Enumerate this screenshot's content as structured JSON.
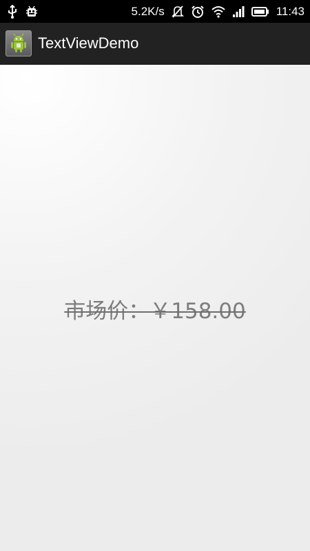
{
  "status_bar": {
    "net_speed": "5.2K/s",
    "time": "11:43",
    "icons": [
      "usb-icon",
      "debug-icon",
      "mute-icon",
      "alarm-icon",
      "wifi-icon",
      "signal-icon",
      "battery-icon"
    ]
  },
  "action_bar": {
    "title": "TextViewDemo",
    "icon": "android-app-icon"
  },
  "content": {
    "price_text": "市场价：￥158.00"
  },
  "colors": {
    "status_bar_bg": "#000000",
    "action_bar_bg": "#222222",
    "content_bg": "#ececec",
    "price_text": "#7d7d7d"
  }
}
